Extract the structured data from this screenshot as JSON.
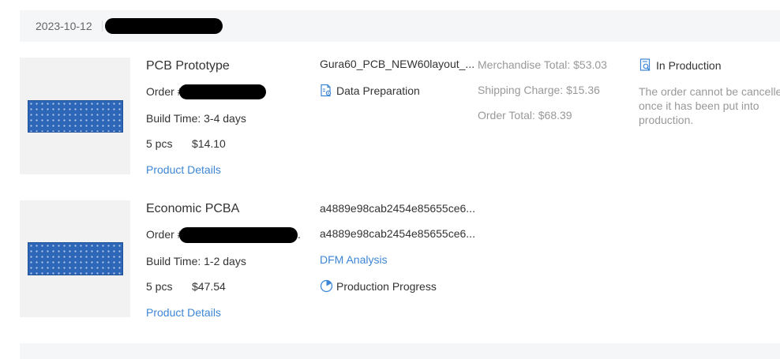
{
  "date_bar": {
    "date": "2023-10-12"
  },
  "orders": [
    {
      "title": "PCB Prototype",
      "order_label": "Order #",
      "build_time": "Build Time: 3-4 days",
      "qty": "5 pcs",
      "price": "$14.10",
      "details_link": "Product Details",
      "file_name": "Gura60_PCB_NEW60layout_...",
      "status_step": "Data Preparation",
      "merch_total": "Merchandise Total: $53.03",
      "shipping": "Shipping Charge: $15.36",
      "order_total": "Order Total: $68.39",
      "prod_status": "In Production",
      "cancel_note": "The order cannot be cancelled once it has been put into production."
    },
    {
      "title": "Economic PCBA",
      "order_label": "Order #",
      "order_suffix": ".",
      "build_time": "Build Time: 1-2 days",
      "qty": "5 pcs",
      "price": "$47.54",
      "details_link": "Product Details",
      "file_name_1": "a4889e98cab2454e85655ce6...",
      "file_name_2": "a4889e98cab2454e85655ce6...",
      "dfm_link": "DFM Analysis",
      "progress_label": "Production Progress"
    }
  ],
  "icons": {
    "data_prep": "document-gear-icon",
    "in_production": "document-search-icon",
    "progress": "progress-circle-icon"
  },
  "colors": {
    "link": "#3d86d6",
    "muted": "#999999",
    "pcb": "#2e67b8"
  }
}
